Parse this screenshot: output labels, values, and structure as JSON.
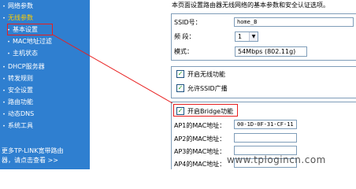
{
  "sidebar": {
    "items": [
      {
        "label": "网络参数"
      },
      {
        "label": "无线参数"
      },
      {
        "label": "基本设置"
      },
      {
        "label": "MAC地址过滤"
      },
      {
        "label": "主机状态"
      },
      {
        "label": "DHCP服务器"
      },
      {
        "label": "转发规则"
      },
      {
        "label": "安全设置"
      },
      {
        "label": "路由功能"
      },
      {
        "label": "动态DNS"
      },
      {
        "label": "系统工具"
      }
    ],
    "footer_line1": "更多TP-LINK宽带路由",
    "footer_line2": "器，请点击查看 >>"
  },
  "description": "本页面设置路由器无线网络的基本参数和安全认证选项。",
  "form": {
    "ssid_label": "SSID号：",
    "ssid_value": "home_B",
    "channel_label": "频  段：",
    "channel_value": "1",
    "mode_label": "模式：",
    "mode_value": "54Mbps (802.11g)",
    "enable_wireless_label": "开启无线功能",
    "allow_ssid_broadcast_label": "允许SSID广播",
    "enable_bridge_label": "开启Bridge功能",
    "ap1_label": "AP1的MAC地址：",
    "ap1_value": "00-1D-0F-31-CF-11",
    "ap2_label": "AP2的MAC地址：",
    "ap2_value": "",
    "ap3_label": "AP3的MAC地址：",
    "ap3_value": "",
    "ap4_label": "AP4的MAC地址：",
    "ap4_value": ""
  },
  "checkbox_states": {
    "enable_wireless": true,
    "allow_ssid_broadcast": true,
    "enable_bridge": true
  },
  "watermark": "www.tplogincn.com",
  "colors": {
    "sidebar_bg": "#2f7fd0",
    "active_item": "#ffcc00",
    "highlight_red": "#e81f1f",
    "check_green": "#21a121"
  }
}
